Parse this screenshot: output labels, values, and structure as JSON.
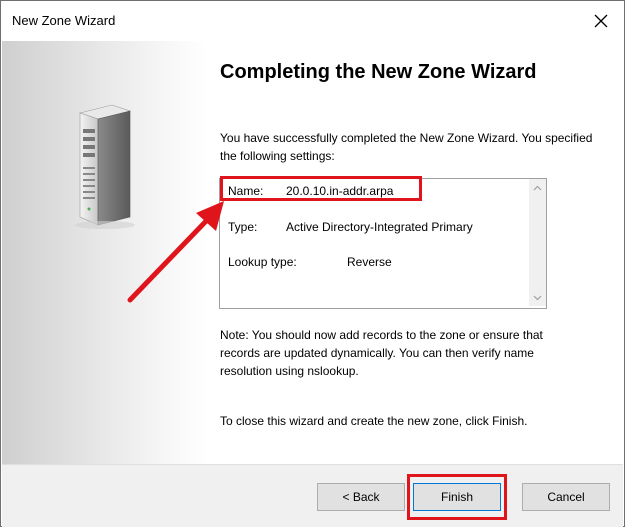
{
  "window": {
    "title": "New Zone Wizard"
  },
  "icons": {
    "close": "close-icon",
    "server": "server-icon"
  },
  "page": {
    "heading": "Completing the New Zone Wizard",
    "intro": "You have successfully completed the New Zone Wizard. You specified the following settings:",
    "settings": [
      {
        "label": "Name:",
        "value": "20.0.10.in-addr.arpa"
      },
      {
        "label": "Type:",
        "value": "Active Directory-Integrated Primary"
      },
      {
        "label": "Lookup type:",
        "value": "Reverse"
      }
    ],
    "note": "Note: You should now add records to the zone or ensure that records are updated dynamically. You can then verify name resolution using nslookup.",
    "close_instruction": "To close this wizard and create the new zone, click Finish."
  },
  "buttons": {
    "back": "< Back",
    "finish": "Finish",
    "cancel": "Cancel"
  },
  "colors": {
    "annotation": "#e0151b",
    "accent": "#0078d7"
  }
}
